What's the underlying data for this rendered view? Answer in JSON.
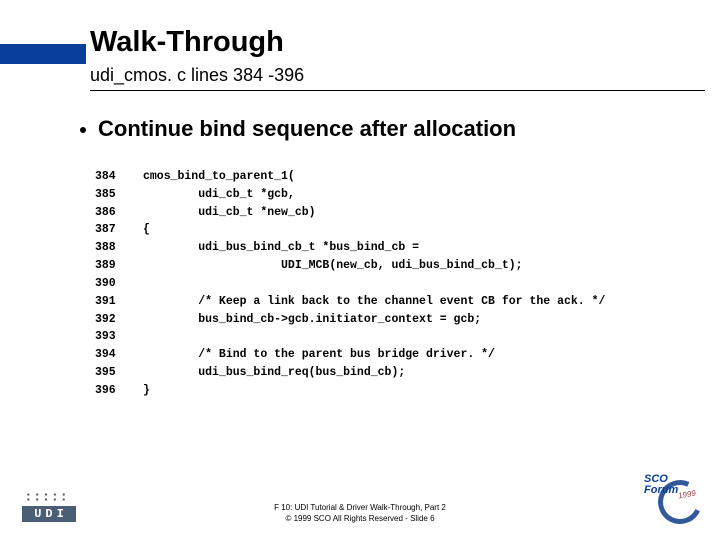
{
  "header": {
    "title": "Walk-Through",
    "subtitle": "udi_cmos. c lines 384 -396"
  },
  "bullet": "Continue bind sequence after allocation",
  "code": [
    {
      "n": "384",
      "t": "cmos_bind_to_parent_1("
    },
    {
      "n": "385",
      "t": "        udi_cb_t *gcb,"
    },
    {
      "n": "386",
      "t": "        udi_cb_t *new_cb)"
    },
    {
      "n": "387",
      "t": "{"
    },
    {
      "n": "388",
      "t": "        udi_bus_bind_cb_t *bus_bind_cb ="
    },
    {
      "n": "389",
      "t": "                    UDI_MCB(new_cb, udi_bus_bind_cb_t);"
    },
    {
      "n": "390",
      "t": ""
    },
    {
      "n": "391",
      "t": "        /* Keep a link back to the channel event CB for the ack. */"
    },
    {
      "n": "392",
      "t": "        bus_bind_cb->gcb.initiator_context = gcb;"
    },
    {
      "n": "393",
      "t": ""
    },
    {
      "n": "394",
      "t": "        /* Bind to the parent bus bridge driver. */"
    },
    {
      "n": "395",
      "t": "        udi_bus_bind_req(bus_bind_cb);"
    },
    {
      "n": "396",
      "t": "}"
    }
  ],
  "footer": {
    "line1": "F 10: UDI Tutorial & Driver Walk-Through, Part 2",
    "line2": "© 1999 SCO  All Rights Reserved - Slide 6"
  },
  "logos": {
    "left_label": "UDI",
    "right_top": "SCO",
    "right_bottom": "Forum",
    "right_year": "1999"
  }
}
